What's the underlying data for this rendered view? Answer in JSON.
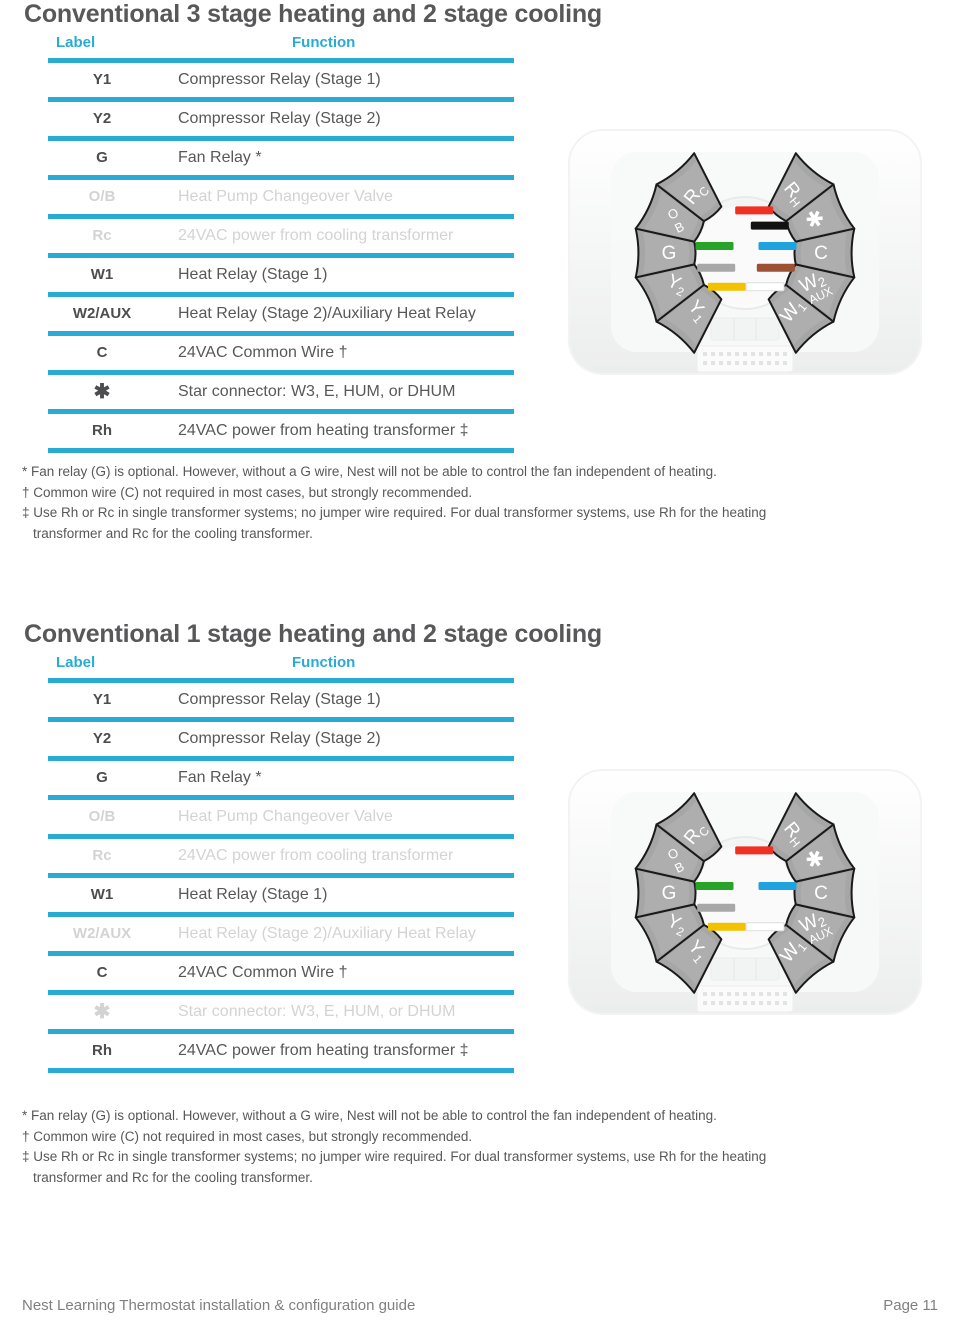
{
  "colors": {
    "accent": "#29abd4",
    "text": "#58585a",
    "dim": "#d3d3d4",
    "wire_yellow": "#f2c200",
    "wire_grey": "#a8a8a8",
    "wire_green": "#27a327",
    "wire_white": "#ffffff",
    "wire_brown": "#9c5132",
    "wire_blue": "#1ea2e0",
    "wire_black": "#111111",
    "wire_red": "#ef3124"
  },
  "table_headers": {
    "label": "Label",
    "function": "Function"
  },
  "sections": [
    {
      "title": "Conventional 3 stage heating and 2 stage cooling",
      "rows": [
        {
          "label": "Y1",
          "function": "Compressor Relay (Stage 1)",
          "dim": false
        },
        {
          "label": "Y2",
          "function": "Compressor Relay (Stage 2)",
          "dim": false
        },
        {
          "label": "G",
          "function": "Fan Relay *",
          "dim": false
        },
        {
          "label": "O/B",
          "function": "Heat Pump Changeover Valve",
          "dim": true
        },
        {
          "label": "Rc",
          "function": "24VAC power from cooling transformer",
          "dim": true
        },
        {
          "label": "W1",
          "function": "Heat Relay (Stage 1)",
          "dim": false
        },
        {
          "label": "W2/AUX",
          "function": "Heat Relay (Stage 2)/Auxiliary Heat Relay",
          "dim": false
        },
        {
          "label": "C",
          "function": "24VAC Common Wire †",
          "dim": false
        },
        {
          "label": "✱",
          "function": "Star connector: W3, E, HUM, or DHUM",
          "dim": false
        },
        {
          "label": "Rh",
          "function": "24VAC power from heating transformer ‡",
          "dim": false
        }
      ],
      "footnotes": [
        "* Fan relay (G) is optional. However, without a G wire, Nest will not be able to control the fan independent of heating.",
        "† Common wire (C) not required in most cases, but strongly recommended.",
        "‡ Use Rh or Rc in single transformer systems; no jumper wire required. For dual transformer systems, use Rh for the heating",
        "transformer and Rc for the cooling transformer."
      ],
      "diagram": {
        "name": "nest-thermostat-base-3-stage",
        "left_terminals": [
          "Y1",
          "Y2",
          "G",
          "O/B",
          "Rc"
        ],
        "right_terminals": [
          "W1",
          "W2/AUX",
          "C",
          "✱",
          "Rh"
        ],
        "wires": [
          {
            "terminal": "Y1",
            "color": "#f2c200",
            "side": "left"
          },
          {
            "terminal": "Y2",
            "color": "#a8a8a8",
            "side": "left"
          },
          {
            "terminal": "G",
            "color": "#27a327",
            "side": "left"
          },
          {
            "terminal": "W1",
            "color": "#ffffff",
            "side": "right"
          },
          {
            "terminal": "W2/AUX",
            "color": "#9c5132",
            "side": "right"
          },
          {
            "terminal": "C",
            "color": "#1ea2e0",
            "side": "right"
          },
          {
            "terminal": "✱",
            "color": "#111111",
            "side": "right"
          },
          {
            "terminal": "Rh",
            "color": "#ef3124",
            "side": "right"
          }
        ]
      }
    },
    {
      "title": "Conventional 1 stage heating and 2 stage cooling",
      "rows": [
        {
          "label": "Y1",
          "function": "Compressor Relay (Stage 1)",
          "dim": false
        },
        {
          "label": "Y2",
          "function": "Compressor Relay (Stage 2)",
          "dim": false
        },
        {
          "label": "G",
          "function": "Fan Relay *",
          "dim": false
        },
        {
          "label": "O/B",
          "function": "Heat Pump Changeover Valve",
          "dim": true
        },
        {
          "label": "Rc",
          "function": "24VAC power from cooling transformer",
          "dim": true
        },
        {
          "label": "W1",
          "function": "Heat Relay (Stage 1)",
          "dim": false
        },
        {
          "label": "W2/AUX",
          "function": "Heat Relay (Stage 2)/Auxiliary Heat Relay",
          "dim": true
        },
        {
          "label": "C",
          "function": "24VAC Common Wire †",
          "dim": false
        },
        {
          "label": "✱",
          "function": "Star connector: W3, E, HUM, or DHUM",
          "dim": true
        },
        {
          "label": "Rh",
          "function": "24VAC power from heating transformer ‡",
          "dim": false
        }
      ],
      "footnotes": [
        "* Fan relay (G) is optional. However, without a G wire, Nest will not be able to control the fan independent of heating.",
        "† Common wire (C) not required in most cases, but strongly recommended.",
        "‡ Use Rh or Rc in single transformer systems; no jumper wire required. For dual transformer systems, use Rh for the heating",
        "transformer and Rc for the cooling transformer."
      ],
      "diagram": {
        "name": "nest-thermostat-base-1-stage",
        "left_terminals": [
          "Y1",
          "Y2",
          "G",
          "O/B",
          "Rc"
        ],
        "right_terminals": [
          "W1",
          "W2/AUX",
          "C",
          "✱",
          "Rh"
        ],
        "wires": [
          {
            "terminal": "Y1",
            "color": "#f2c200",
            "side": "left"
          },
          {
            "terminal": "Y2",
            "color": "#a8a8a8",
            "side": "left"
          },
          {
            "terminal": "G",
            "color": "#27a327",
            "side": "left"
          },
          {
            "terminal": "W1",
            "color": "#ffffff",
            "side": "right"
          },
          {
            "terminal": "C",
            "color": "#1ea2e0",
            "side": "right"
          },
          {
            "terminal": "Rh",
            "color": "#ef3124",
            "side": "right"
          }
        ]
      }
    }
  ],
  "footer": {
    "left": "Nest Learning Thermostat installation & configuration guide",
    "right": "Page 11"
  }
}
